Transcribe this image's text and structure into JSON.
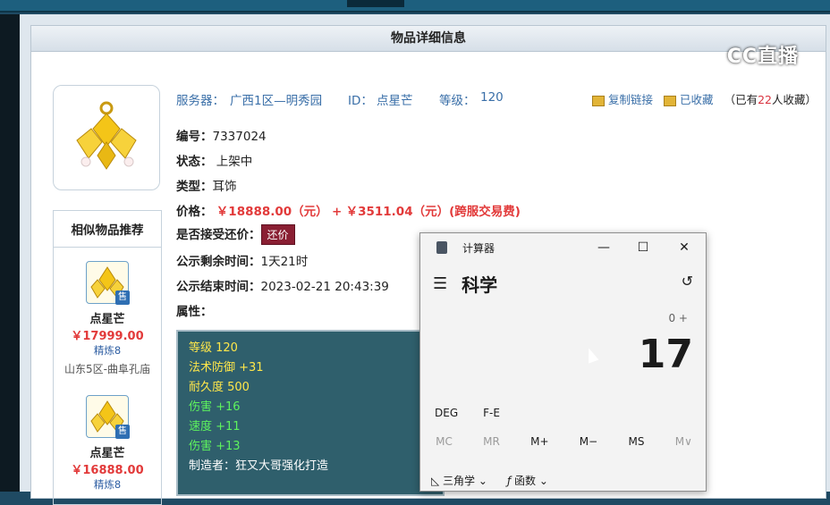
{
  "topnav": {
    "tabs": [
      "",
      "",
      "",
      "",
      "",
      "",
      "",
      ""
    ]
  },
  "panel": {
    "title": "物品详细信息"
  },
  "logo": {
    "text": "CC直播"
  },
  "item": {
    "server_label": "服务器：",
    "server": "广西1区—明秀园",
    "id_label": "ID：",
    "id": "点星芒",
    "level_label": "等级：",
    "level": "120",
    "copy_link": "复制链接",
    "favorited": "已收藏",
    "fav_count_prefix": "（已有",
    "fav_count": "22",
    "fav_count_suffix": "人收藏）",
    "serial_label": "编号：",
    "serial": "7337024",
    "status_label": "状态：",
    "status": "上架中",
    "type_label": "类型：",
    "type": "耳饰",
    "price_label": "价格：",
    "price": "￥18888.00（元）",
    "price_plus": "+",
    "fee": "￥3511.04（元）(跨服交易费)",
    "bargain_label": "是否接受还价：",
    "bargain_button": "还价",
    "remain_label": "公示剩余时间：",
    "remain": "1天21时",
    "end_label": "公示结束时间：",
    "end": "2023-02-21 20:43:39",
    "attr_label": "属性："
  },
  "attributes": [
    {
      "text": "等级 120",
      "color": "yellow"
    },
    {
      "text": "法术防御 +31",
      "color": "yellow"
    },
    {
      "text": "耐久度 500",
      "color": "yellow"
    },
    {
      "text": "伤害 +16",
      "color": "green"
    },
    {
      "text": "速度 +11",
      "color": "green"
    },
    {
      "text": "伤害 +13",
      "color": "green"
    },
    {
      "text": "制造者：狂又大哥强化打造",
      "color": "white"
    }
  ],
  "similar": {
    "title": "相似物品推荐",
    "sell_badge": "售",
    "items": [
      {
        "name": "点星芒",
        "price": "￥17999.00",
        "refine": "精炼8",
        "server": "山东5区-曲阜孔庙"
      },
      {
        "name": "点星芒",
        "price": "￥16888.00",
        "refine": "精炼8",
        "server": ""
      }
    ]
  },
  "calculator": {
    "title": "计算器",
    "mode": "科学",
    "expression": "0 +",
    "result": "17",
    "deg": "DEG",
    "fe": "F-E",
    "memory": [
      "MC",
      "MR",
      "M+",
      "M−",
      "MS",
      "M∨"
    ],
    "trig": "三角学",
    "func": "函数",
    "minimize": "—",
    "maximize": "☐",
    "close": "✕"
  }
}
